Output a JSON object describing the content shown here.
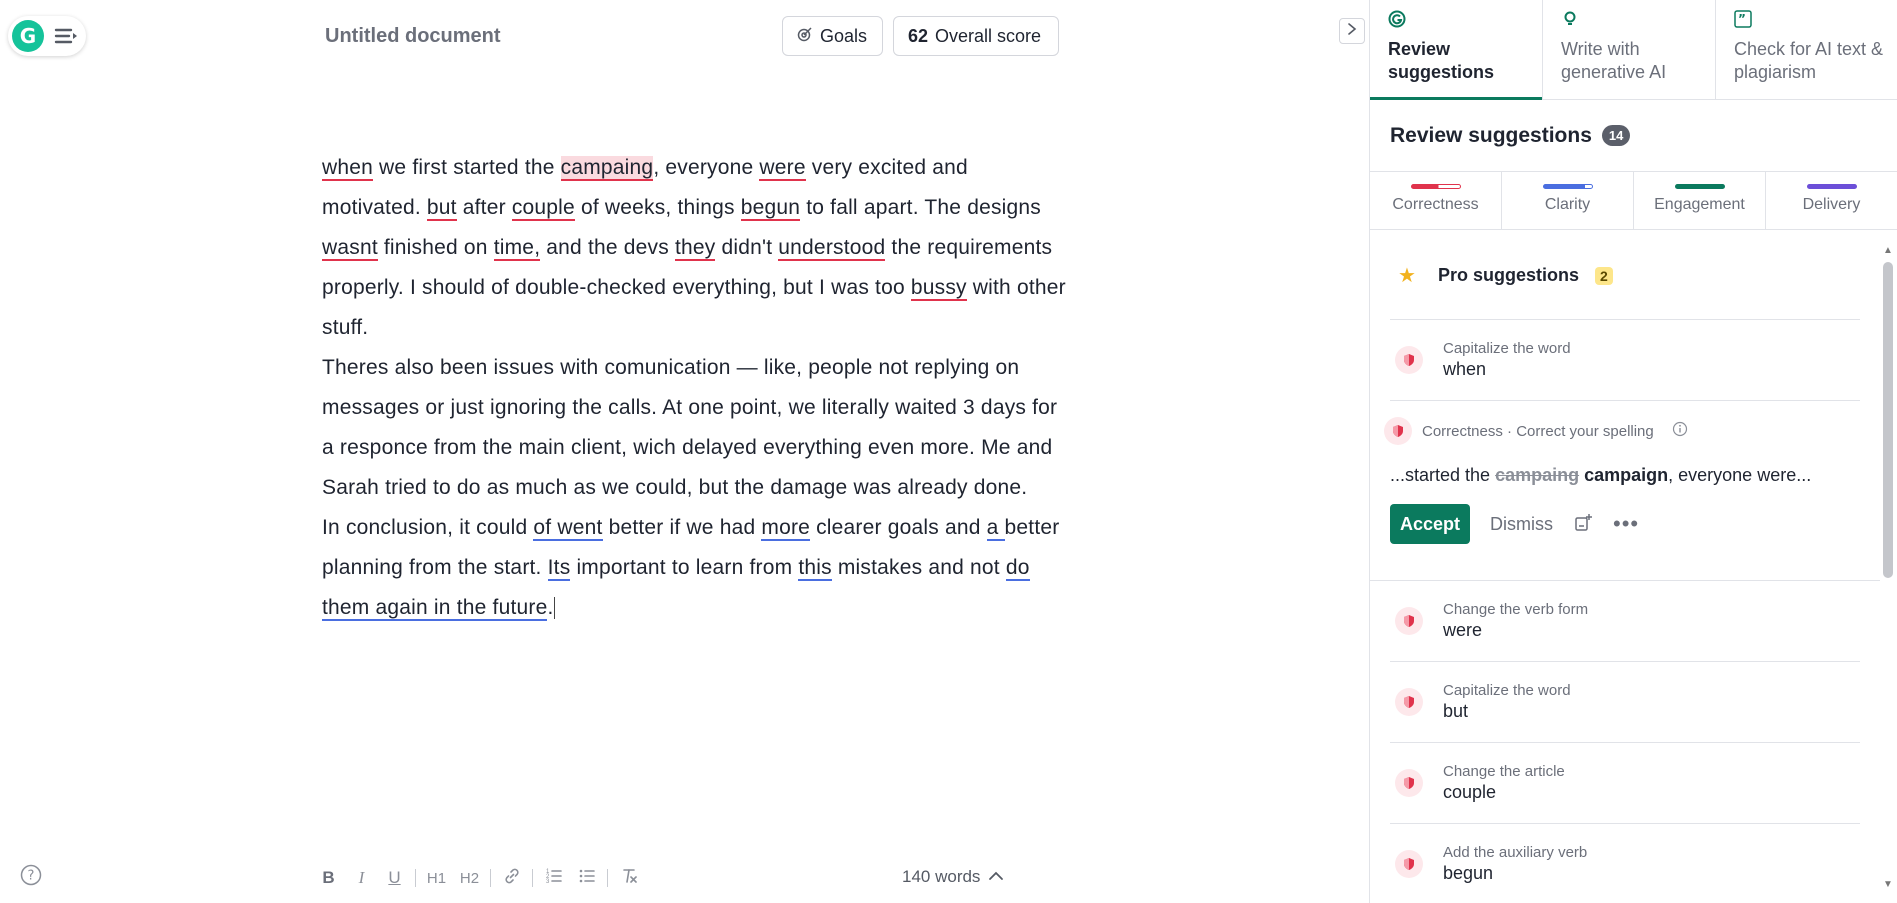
{
  "doc": {
    "title": "Untitled document",
    "goals_label": "Goals",
    "score_value": "62",
    "score_label": "Overall score"
  },
  "editor": {
    "p1": [
      {
        "t": "when",
        "s": "ur"
      },
      {
        "t": " we first started the "
      },
      {
        "t": "campaing",
        "s": "hl"
      },
      {
        "t": ", everyone "
      },
      {
        "t": "were",
        "s": "ur"
      },
      {
        "t": " very excited and motivated. "
      },
      {
        "t": "but",
        "s": "ur"
      },
      {
        "t": " after "
      },
      {
        "t": "couple",
        "s": "ur"
      },
      {
        "t": " of weeks, things "
      },
      {
        "t": "begun",
        "s": "ur"
      },
      {
        "t": " to fall apart. The designs "
      },
      {
        "t": "wasnt",
        "s": "ur"
      },
      {
        "t": " finished on "
      },
      {
        "t": "time,",
        "s": "ur"
      },
      {
        "t": " and the devs "
      },
      {
        "t": "they",
        "s": "ur"
      },
      {
        "t": " didn't "
      },
      {
        "t": "understood",
        "s": "ur"
      },
      {
        "t": " the requirements properly. I should of double-checked everything, but I was too "
      },
      {
        "t": "bussy",
        "s": "ur"
      },
      {
        "t": " with other stuff."
      }
    ],
    "p2": [
      {
        "t": "Theres also been issues with comunication — like, people not replying on messages or just ignoring the calls. At one point, we literally waited 3 days for a responce from the main client, wich delayed everything even more. Me and Sarah tried to do as much as we could, but the damage was already done."
      }
    ],
    "p3": [
      {
        "t": "In conclusion, it could "
      },
      {
        "t": "of went",
        "s": "ub"
      },
      {
        "t": " better if we had "
      },
      {
        "t": "more",
        "s": "ub"
      },
      {
        "t": " clearer goals and "
      },
      {
        "t": "a ",
        "s": "ub"
      },
      {
        "t": "better planning from the start. "
      },
      {
        "t": "Its",
        "s": "ub"
      },
      {
        "t": " important to learn from "
      },
      {
        "t": "this",
        "s": "ub"
      },
      {
        "t": " mistakes and not "
      },
      {
        "t": "do them again in the future",
        "s": "ub"
      },
      {
        "t": "."
      }
    ]
  },
  "toolbar": {
    "items": [
      "B",
      "I",
      "U",
      "|",
      "H1",
      "H2",
      "|",
      "link",
      "|",
      "ol",
      "ul",
      "|",
      "clear"
    ],
    "word_count": "140 words"
  },
  "panel": {
    "tabs": [
      {
        "label": "Review suggestions",
        "icon": "grammarly-icon",
        "active": true
      },
      {
        "label": "Write with generative AI",
        "icon": "lightbulb-icon",
        "active": false
      },
      {
        "label": "Check for AI text & plagiarism",
        "icon": "quote-icon",
        "active": false
      }
    ],
    "review_title": "Review suggestions",
    "review_count": "14",
    "categories": [
      {
        "label": "Correctness",
        "color": "#e0334c"
      },
      {
        "label": "Clarity",
        "color": "#4a6ee0"
      },
      {
        "label": "Engagement",
        "color": "#0b7a5e"
      },
      {
        "label": "Delivery",
        "color": "#6c4fd8"
      }
    ],
    "pro": {
      "label": "Pro suggestions",
      "count": "2"
    },
    "suggestions": [
      {
        "sub": "Capitalize the word",
        "word": "when"
      }
    ],
    "expanded": {
      "header": "Correctness · Correct your spelling",
      "prefix": "...started the ",
      "old": "campaing",
      "new": "campaign",
      "suffix": ", everyone were...",
      "accept": "Accept",
      "dismiss": "Dismiss"
    },
    "suggestions_after": [
      {
        "sub": "Change the verb form",
        "word": "were"
      },
      {
        "sub": "Capitalize the word",
        "word": "but"
      },
      {
        "sub": "Change the article",
        "word": "couple"
      },
      {
        "sub": "Add the auxiliary verb",
        "word": "begun"
      }
    ]
  }
}
